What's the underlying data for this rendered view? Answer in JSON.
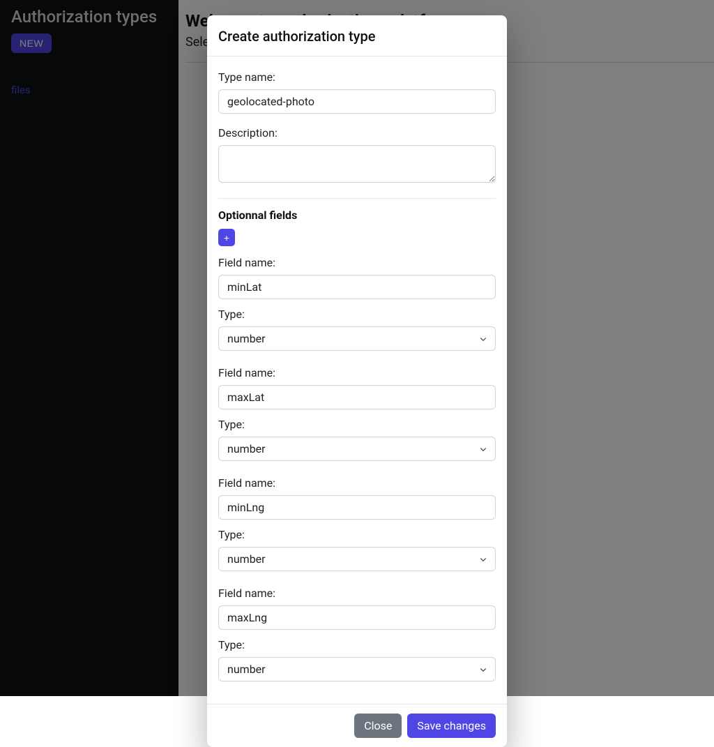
{
  "sidebar": {
    "title": "Authorization types",
    "new_button": "NEW",
    "items": [
      {
        "label": "files"
      }
    ]
  },
  "main": {
    "title": "Welcome to authorizations platform",
    "subtitle_prefix": "Sele"
  },
  "modal": {
    "title": "Create authorization type",
    "type_name_label": "Type name:",
    "type_name_value": "geolocated-photo",
    "description_label": "Description:",
    "description_value": "",
    "optional_section_title": "Optionnal fields",
    "add_button": "+",
    "field_name_label": "Field name:",
    "type_label": "Type:",
    "fields": [
      {
        "name": "minLat",
        "type": "number"
      },
      {
        "name": "maxLat",
        "type": "number"
      },
      {
        "name": "minLng",
        "type": "number"
      },
      {
        "name": "maxLng",
        "type": "number"
      }
    ],
    "close_button": "Close",
    "save_button": "Save changes"
  }
}
